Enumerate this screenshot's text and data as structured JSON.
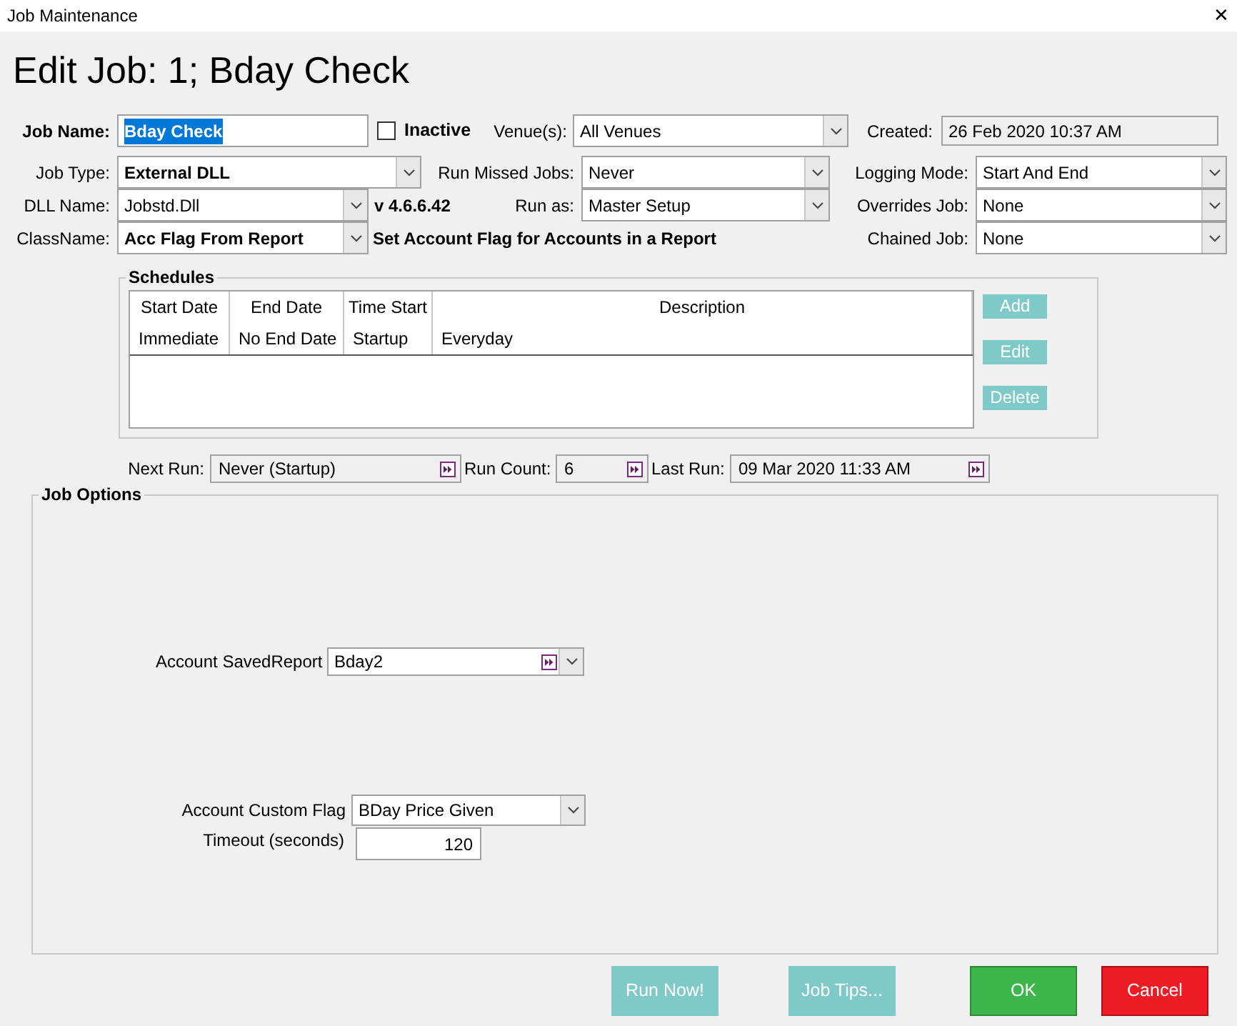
{
  "window": {
    "title": "Job Maintenance",
    "close": "✕"
  },
  "heading": "Edit Job: 1; Bday Check",
  "job_name": {
    "label": "Job Name:",
    "value": "Bday Check",
    "selected": true
  },
  "inactive": {
    "label": "Inactive",
    "checked": false
  },
  "venues": {
    "label": "Venue(s):",
    "value": "All Venues"
  },
  "created": {
    "label": "Created:",
    "value": "26 Feb 2020 10:37 AM"
  },
  "job_type": {
    "label": "Job Type:",
    "value": "External DLL"
  },
  "run_missed_jobs": {
    "label": "Run Missed Jobs:",
    "value": "Never"
  },
  "logging_mode": {
    "label": "Logging Mode:",
    "value": "Start And End"
  },
  "dll_name": {
    "label": "DLL Name:",
    "value": "Jobstd.Dll"
  },
  "version": "v 4.6.6.42",
  "run_as": {
    "label": "Run as:",
    "value": "Master Setup"
  },
  "overrides_job": {
    "label": "Overrides Job:",
    "value": "None"
  },
  "class_name": {
    "label": "ClassName:",
    "value": "Acc Flag From Report"
  },
  "class_description": "Set Account Flag for Accounts in a Report",
  "chained_job": {
    "label": "Chained Job:",
    "value": "None"
  },
  "schedules": {
    "title": "Schedules",
    "columns": [
      "Start Date",
      "End Date",
      "Time Start",
      "Description"
    ],
    "rows": [
      [
        "Immediate",
        "No End Date",
        "Startup",
        "Everyday"
      ]
    ],
    "buttons": [
      "Add",
      "Edit",
      "Delete"
    ]
  },
  "run_info": [
    {
      "label": "Next Run:",
      "value": "Never (Startup)"
    },
    {
      "label": "Run Count:",
      "value": "6"
    },
    {
      "label": "Last Run:",
      "value": "09 Mar 2020 11:33 AM"
    }
  ],
  "job_options": {
    "title": "Job Options",
    "saved_report": {
      "label": "Account SavedReport",
      "value": "Bday2"
    },
    "custom_flag": {
      "label": "Account Custom Flag",
      "value": "BDay Price Given"
    },
    "timeout": {
      "label": "Timeout (seconds)",
      "value": "120"
    }
  },
  "buttons": [
    {
      "label": "Run Now!",
      "kind": "secondary"
    },
    {
      "label": "Job Tips...",
      "kind": "secondary"
    },
    {
      "label": "OK",
      "kind": "ok"
    },
    {
      "label": "Cancel",
      "kind": "cancel"
    }
  ]
}
